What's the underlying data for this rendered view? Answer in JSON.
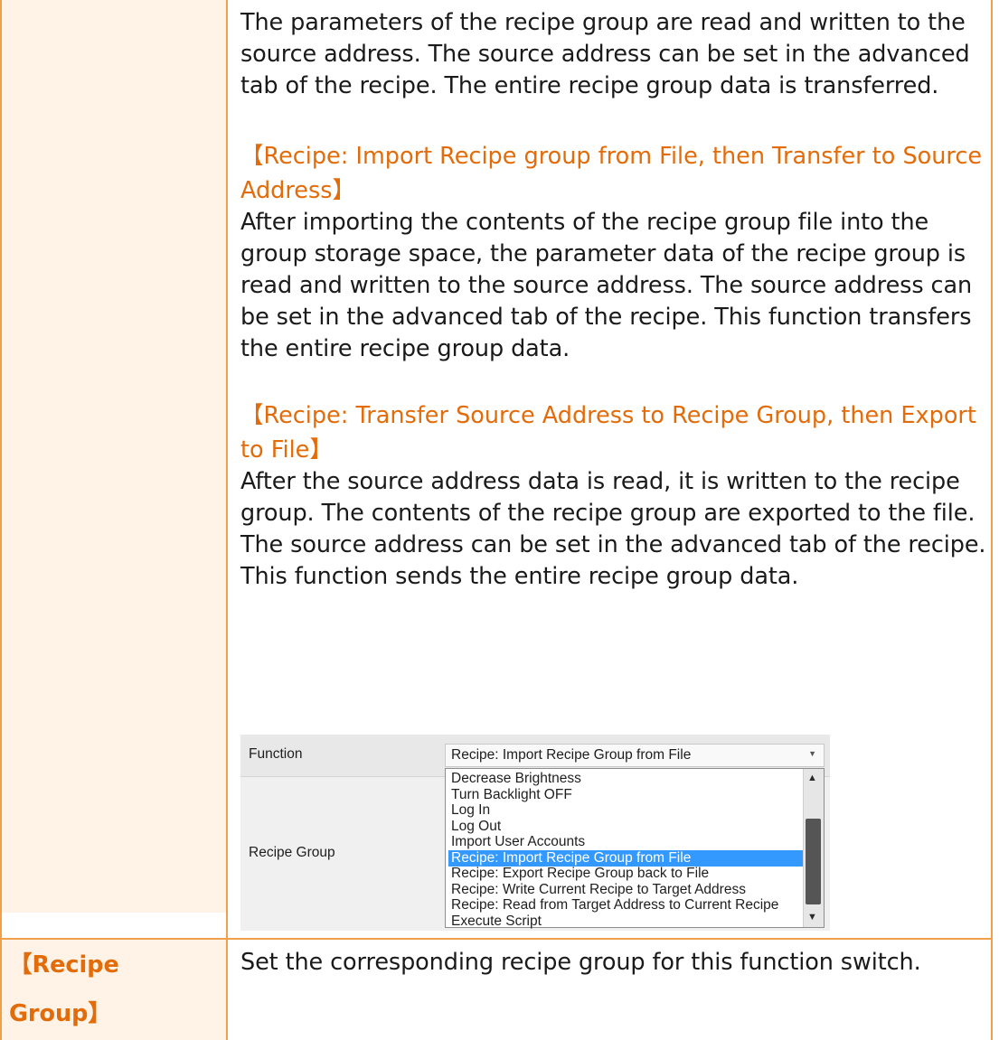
{
  "intro_paragraph": "The parameters of the recipe group are read and written to the source address. The source address can be set in the advanced tab of the recipe. The entire recipe group data is transferred.",
  "section1": {
    "heading_line1": "【Recipe: Import Recipe group from File, then Transfer to Source",
    "heading_line2": "Address】",
    "body": "After importing the contents of the recipe group file into the group storage space, the parameter data of the recipe group is read and written to the source address. The source address can be set in the advanced tab of the recipe. This function transfers the entire recipe group data."
  },
  "section2": {
    "heading_line1": "【Recipe: Transfer Source Address to Recipe Group, then Export",
    "heading_line2": "to File】",
    "body": "After the source address data is read, it is written to the recipe group. The contents of the recipe group are exported to the file. The source address can be set in the advanced tab of the recipe. This function sends the entire recipe group data."
  },
  "screenshot": {
    "function_label": "Function",
    "recipe_group_label": "Recipe Group",
    "selected_value": "Recipe: Import Recipe Group from File",
    "options": [
      "Decrease Brightness",
      "Turn Backlight OFF",
      "Log In",
      "Log Out",
      "Import User Accounts",
      "Recipe: Import Recipe Group from File",
      "Recipe: Export Recipe Group back to File",
      "Recipe: Write Current Recipe to Target Address",
      "Recipe: Read from Target Address to Current Recipe",
      "Execute Script"
    ],
    "highlighted_option": "Recipe: Import Recipe Group from File"
  },
  "bottom_row": {
    "label_line1": "【Recipe",
    "label_line2": "Group】",
    "description": "Set the corresponding recipe group for this function switch."
  },
  "colors": {
    "border": "#f0a04b",
    "label_bg": "#fef3e6",
    "heading": "#e36c0a",
    "highlight": "#3399ff"
  }
}
